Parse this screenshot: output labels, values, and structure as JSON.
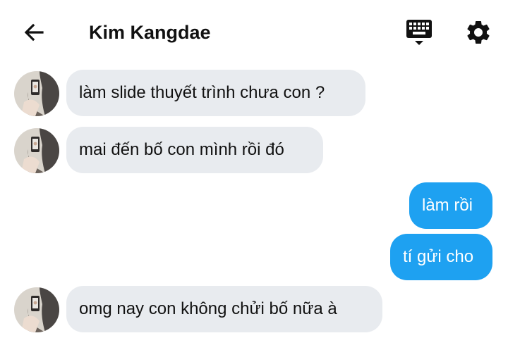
{
  "header": {
    "title": "Kim Kangdae",
    "back_icon": "arrow-left-icon",
    "keyboard_icon": "keyboard-icon",
    "settings_icon": "gear-icon"
  },
  "colors": {
    "incoming_bubble": "#e8ebef",
    "outgoing_bubble": "#1ea1f1",
    "text": "#111111"
  },
  "messages": [
    {
      "direction": "incoming",
      "text": "làm slide thuyết trình chưa con ?"
    },
    {
      "direction": "incoming",
      "text": "mai đến bố con mình rồi đó"
    },
    {
      "direction": "outgoing",
      "text": "làm rồi"
    },
    {
      "direction": "outgoing",
      "text": "tí gửi cho"
    },
    {
      "direction": "incoming",
      "text": "omg nay con không chửi bố nữa à"
    }
  ]
}
